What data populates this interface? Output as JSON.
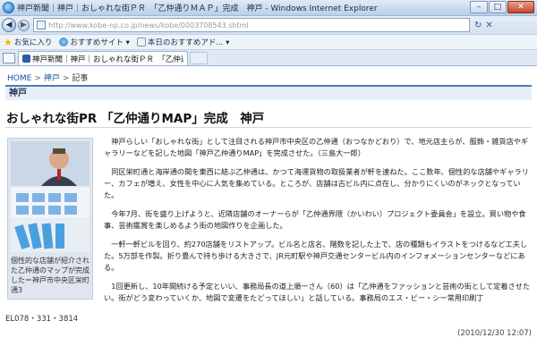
{
  "window": {
    "title": "神戸新聞｜神戸｜おしゃれな街ＰＲ　「乙仲通りＭＡＰ」完成　神戸 - Windows Internet Explorer",
    "minimize": "–",
    "maximize": "□",
    "close": "✕"
  },
  "address": {
    "url": "http://www.kobe-np.co.jp/news/kobe/0003708543.shtml"
  },
  "favorites": {
    "favorites_label": "お気に入り",
    "items": [
      {
        "label": "おすすめサイト ▾"
      },
      {
        "label": "本日のおすすめアド... ▾"
      }
    ]
  },
  "tab": {
    "label": "神戸新聞｜神戸｜おしゃれな街ＰＲ　「乙仲通..."
  },
  "breadcrumb": {
    "home": "HOME",
    "kobe": "神戸",
    "current": "記事",
    "sep": ">"
  },
  "section": {
    "title": "神戸"
  },
  "article": {
    "headline": "おしゃれな街PR 「乙仲通りMAP」完成　神戸",
    "caption": "個性的な店舗が紹介された乙仲通のマップが完成した＝神戸市中央区栄町通3",
    "tel": "EL078・331・3814",
    "paragraphs": [
      "神戸らしい「おしゃれな街」として注目される神戸市中央区の乙仲通（おつなかどおり）で、地元店主らが、服飾・雑貨店やギャラリーなどを記した地図「神戸乙仲通りMAP」を完成させた。（三島大一郎）",
      "同区栄町通と海岸通の間を東西に結ぶ乙仲通は、かつて海運貨物の取扱業者が軒を連ねた。ここ数年、個性的な店舗やギャラリー、カフェが増え、女性を中心に人気を集めている。ところが、店舗は古ビル内に点在し、分かりにくいのがネックとなっていた。",
      "今年7月、街を盛り上げようと、近隣店舗のオーナーらが「乙仲通界隈（かいわい）プロジェクト委員会」を設立。買い物や食事、芸術鑑賞を楽しめるよう街の地図作りを企画した。",
      "一軒一軒ビルを回り、約270店舗をリストアップ。ビル名と店名、階数を記した上で、店の種類もイラストをつけるなど工夫した。5万部を作製。折り畳んで持ち歩ける大きさで、JR元町駅や神戸交通センタービル内のインフォメーションセンターなどにある。",
      "1回更新し、10年間続ける予定といい、事務局長の道上順一さん（60）は「乙仲通をファッションと芸術の街として定着させたい。街がどう変わっていくか、地図で変遷をたどってほしい」と話している。事務局のエス・ピー・シー常用印刷丁"
    ],
    "date": "(2010/12/30 12:07)"
  },
  "colors": {
    "link": "#1f4ea3",
    "section_border": "#4f79b7"
  }
}
